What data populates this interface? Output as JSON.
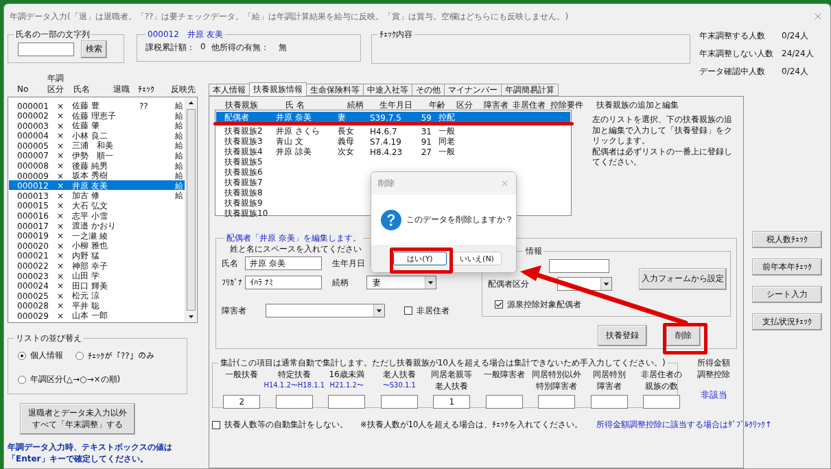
{
  "window": {
    "title": "年調データ入力(「退」は退職者。「??」は要チェックデータ。「給」は年調計算結果を給与に反映。「賞」は賞与。空欄はどちらにも反映しません。)"
  },
  "search": {
    "label": "氏名の一部の文字列",
    "button": "検索"
  },
  "employee": {
    "heading": "000012　井原 友美",
    "taxable_label": "課税累計額：",
    "taxable_value": "0",
    "other_income_label": "他所得の有無：",
    "other_income_value": "無"
  },
  "check": {
    "label": "ﾁｪｯｸ内容"
  },
  "stats": [
    {
      "label": "年末調整する人数",
      "value": "0/24人"
    },
    {
      "label": "年末調整しない人数",
      "value": "24/24人"
    },
    {
      "label": "データ確認中人数",
      "value": "0/24人"
    }
  ],
  "employee_list": {
    "columns": [
      "No",
      "年調区分",
      "氏名",
      "退職",
      "ﾁｪｯｸ",
      "反映先"
    ],
    "rows": [
      {
        "no": "000001",
        "kubun": "×",
        "name": "佐藤 豊",
        "check": "??",
        "target": "給",
        "selected": false
      },
      {
        "no": "000002",
        "kubun": "×",
        "name": "佐藤 理恵子",
        "target": "給",
        "selected": false
      },
      {
        "no": "000003",
        "kubun": "×",
        "name": "佐藤 肇",
        "target": "給",
        "selected": false
      },
      {
        "no": "000004",
        "kubun": "×",
        "name": "小林 良二",
        "target": "給",
        "selected": false
      },
      {
        "no": "000005",
        "kubun": "×",
        "name": "三浦　和美",
        "target": "給",
        "selected": false
      },
      {
        "no": "000007",
        "kubun": "×",
        "name": "伊勢　順一",
        "target": "給",
        "selected": false
      },
      {
        "no": "000008",
        "kubun": "×",
        "name": "後藤 純男",
        "target": "給",
        "selected": false
      },
      {
        "no": "000009",
        "kubun": "×",
        "name": "坂本 秀樹",
        "target": "給",
        "selected": false
      },
      {
        "no": "000012",
        "kubun": "×",
        "name": "井原 友美",
        "target": "給",
        "selected": true
      },
      {
        "no": "000013",
        "kubun": "×",
        "name": "加古 修",
        "target": "給",
        "selected": false
      },
      {
        "no": "000015",
        "kubun": "×",
        "name": "大石 弘文",
        "selected": false
      },
      {
        "no": "000016",
        "kubun": "×",
        "name": "志平 小雪",
        "selected": false
      },
      {
        "no": "000017",
        "kubun": "×",
        "name": "渡邉 かおり",
        "selected": false
      },
      {
        "no": "000019",
        "kubun": "×",
        "name": "一之瀬 綾",
        "selected": false
      },
      {
        "no": "000020",
        "kubun": "×",
        "name": "小柳 雅也",
        "selected": false
      },
      {
        "no": "000021",
        "kubun": "×",
        "name": "内野 猛",
        "selected": false
      },
      {
        "no": "000022",
        "kubun": "×",
        "name": "神部 幸子",
        "selected": false
      },
      {
        "no": "000023",
        "kubun": "×",
        "name": "山田 学",
        "selected": false
      },
      {
        "no": "000024",
        "kubun": "×",
        "name": "田口 輝美",
        "selected": false
      },
      {
        "no": "000025",
        "kubun": "×",
        "name": "松元 涼",
        "selected": false
      },
      {
        "no": "000028",
        "kubun": "×",
        "name": "平井 聡",
        "selected": false
      },
      {
        "no": "000029",
        "kubun": "×",
        "name": "山本 一郎",
        "selected": false
      }
    ]
  },
  "sort": {
    "label": "リストの並び替え",
    "options": [
      {
        "label": "個人情報",
        "selected": true
      },
      {
        "label": "ﾁｪｯｸが「??」のみ",
        "selected": false
      },
      {
        "label": "年調区分(△→○→×の順)",
        "selected": false
      }
    ]
  },
  "bulk_button": [
    "退職者とデータ未入力以外",
    "すべて「年末調整」する"
  ],
  "note": "年調データ入力時、テキストボックスの値は「Enter」キーで確定してください。",
  "tabs": [
    {
      "label": "本人情報",
      "selected": false
    },
    {
      "label": "扶養親族情報",
      "selected": true
    },
    {
      "label": "生命保険料等",
      "selected": false
    },
    {
      "label": "中途入社等",
      "selected": false
    },
    {
      "label": "その他",
      "selected": false
    },
    {
      "label": "マイナンバー",
      "selected": false
    },
    {
      "label": "年調簡易計算",
      "selected": false
    }
  ],
  "dependents": {
    "columns": [
      "扶養親族",
      "氏 名",
      "続柄",
      "生年月日",
      "年齢",
      "区分",
      "障害者",
      "非居住者",
      "控除要件"
    ],
    "rows": [
      {
        "slot": "配偶者",
        "name": "井原 奈美",
        "relation": "妻",
        "birth": "S39.7.5",
        "age": "59",
        "category": "控配",
        "selected": true
      },
      {
        "slot": "扶養親族2",
        "name": "井原 さくら",
        "relation": "長女",
        "birth": "H4.6.7",
        "age": "31",
        "category": "一般",
        "selected": false
      },
      {
        "slot": "扶養親族3",
        "name": "青山 文",
        "relation": "義母",
        "birth": "S7.4.19",
        "age": "91",
        "category": "同老",
        "selected": false
      },
      {
        "slot": "扶養親族4",
        "name": "井原 諒美",
        "relation": "次女",
        "birth": "H8.4.23",
        "age": "27",
        "category": "一般",
        "selected": false
      },
      {
        "slot": "扶養親族5",
        "selected": false
      },
      {
        "slot": "扶養親族6",
        "selected": false
      },
      {
        "slot": "扶養親族7",
        "selected": false
      },
      {
        "slot": "扶養親族8",
        "selected": false
      },
      {
        "slot": "扶養親族9",
        "selected": false
      },
      {
        "slot": "扶養親族10",
        "selected": false
      }
    ]
  },
  "help": {
    "title": "扶養親族の追加と編集",
    "paragraphs": [
      "左のリストを選択、下の扶養親族の追加と編集で入力して「扶養登録」をクリックします。",
      "配偶者は必ずリストの一番上に登録してください。"
    ]
  },
  "edit": {
    "heading": "配偶者「井原 奈美」を編集します。",
    "hint": "姓と名にスペースを入れてください",
    "name_label": "氏名",
    "name_value": "井原 奈美",
    "kana_label": "ﾌﾘｶﾞﾅ",
    "kana_value": "ｲﾊﾗ ﾅﾐ",
    "birth_label": "生年月日",
    "relation_label": "続柄",
    "relation_value": "妻",
    "disability_label": "障害者",
    "nonresident": {
      "label": "非居住者",
      "checked": false
    },
    "spouse_group": {
      "heading": "情報",
      "category_label": "配偶者区分",
      "set_button": "入力フォームから設定",
      "withholding": {
        "label": "源泉控除対象配偶者",
        "checked": true
      }
    },
    "register_button": "扶養登録",
    "delete_button": "削除"
  },
  "totals": {
    "heading": "集計(この項目は通常自動で集計します。ただし扶養親族が10人を超える場合は集計できないため手入力してください。)",
    "fields": [
      {
        "label": [
          "一般扶養"
        ],
        "value": "2"
      },
      {
        "label": [
          "特定扶養"
        ],
        "range": "H14.1.2〜H18.1.1"
      },
      {
        "label": [
          "16歳未満"
        ],
        "range": "H21.1.2〜"
      },
      {
        "label": [
          "老人扶養"
        ],
        "range": "〜S30.1.1"
      },
      {
        "label": [
          "同居老親等",
          "老人扶養"
        ],
        "value": "1"
      },
      {
        "label": [
          "一般障害者"
        ]
      },
      {
        "label": [
          "同居特別以外",
          "特別障害者"
        ]
      },
      {
        "label": [
          "同居特別",
          "障害者"
        ]
      },
      {
        "label": [
          "非居住者の",
          "親族の数"
        ]
      }
    ]
  },
  "adjustment": {
    "label": [
      "所得金額",
      "調整控除"
    ],
    "value": "非該当"
  },
  "auto_checkbox": {
    "label": "扶養人数等の自動集計をしない。",
    "checked": false
  },
  "auto_note": "※扶養人数が10人を超える場合は、ﾁｪｯｸを入れてください。",
  "adjust_link": "所得金額調整控除に該当する場合はﾀﾞﾌﾞﾙｸﾘｯｸ↑",
  "side_buttons": [
    "税人数ﾁｪｯｸ",
    "前年本年ﾁｪｯｸ",
    "シート入力",
    "支払状況ﾁｪｯｸ"
  ],
  "dialog": {
    "title": "削除",
    "message": "このデータを削除しますか？",
    "buttons": [
      {
        "label": "はい(Y)",
        "selected": true
      },
      {
        "label": "いいえ(N)",
        "selected": false
      }
    ]
  }
}
